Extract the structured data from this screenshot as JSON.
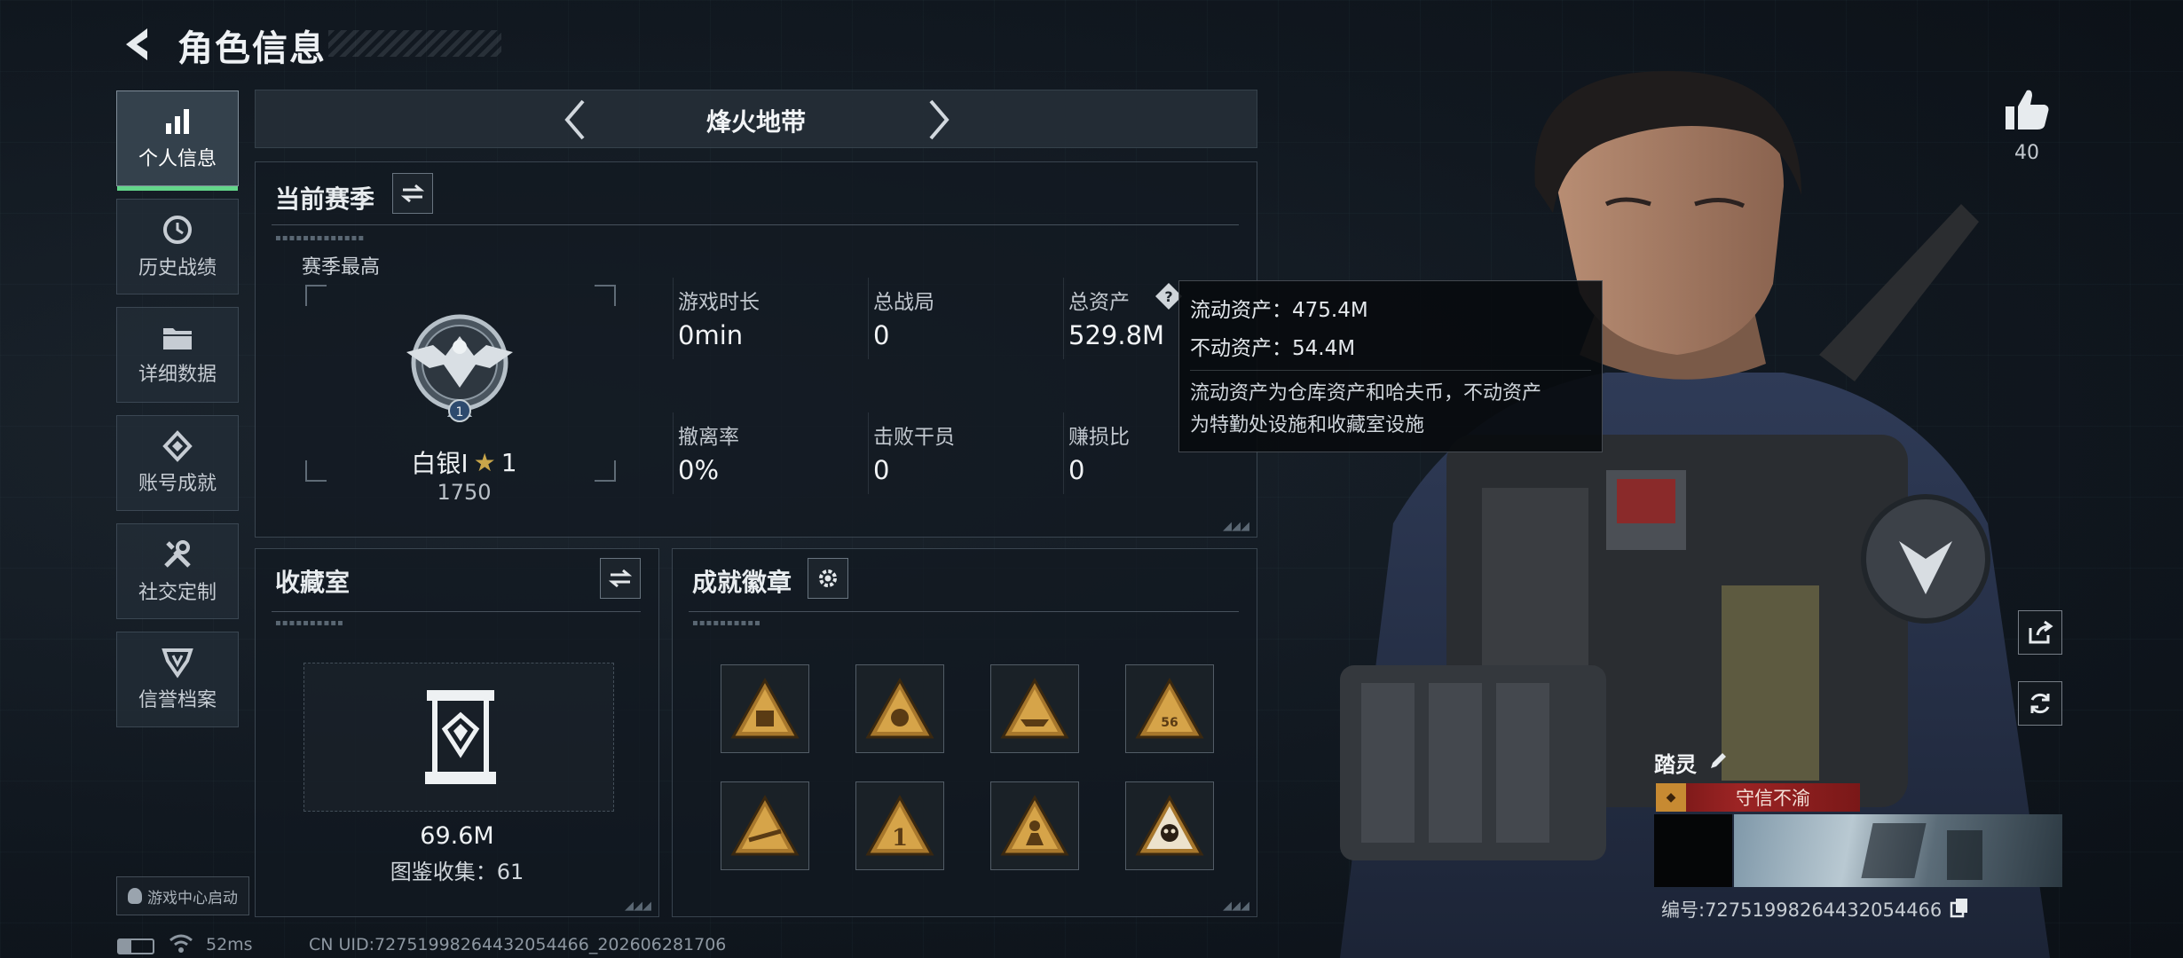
{
  "header": {
    "title": "角色信息"
  },
  "sidebar": {
    "items": [
      {
        "label": "个人信息",
        "icon": "bar-chart-icon",
        "active": true
      },
      {
        "label": "历史战绩",
        "icon": "history-clock-icon",
        "active": false
      },
      {
        "label": "详细数据",
        "icon": "folder-icon",
        "active": false
      },
      {
        "label": "账号成就",
        "icon": "achievement-diamond-icon",
        "active": false
      },
      {
        "label": "社交定制",
        "icon": "tools-icon",
        "active": false
      },
      {
        "label": "信誉档案",
        "icon": "shield-badge-icon",
        "active": false
      }
    ],
    "launch_label": "游戏中心启动"
  },
  "mode": {
    "name": "烽火地带"
  },
  "season": {
    "title": "当前赛季",
    "best_label": "赛季最高",
    "rank_name": "白银I",
    "rank_star": "1",
    "rank_points": "1750",
    "stats": [
      {
        "label": "游戏时长",
        "value": "0min"
      },
      {
        "label": "总战局",
        "value": "0"
      },
      {
        "label": "总资产",
        "value": "529.8M"
      },
      {
        "label": "撤离率",
        "value": "0%"
      },
      {
        "label": "击败干员",
        "value": "0"
      },
      {
        "label": "赚损比",
        "value": "0"
      }
    ]
  },
  "tooltip": {
    "liquid": "流动资产：475.4M",
    "fixed": "不动资产：54.4M",
    "desc_line1": "流动资产为仓库资产和哈夫币，不动资产",
    "desc_line2": "为特勤处设施和收藏室设施"
  },
  "collection": {
    "title": "收藏室",
    "value": "69.6M",
    "catalog": "图鉴收集：61"
  },
  "badges": {
    "title": "成就徽章",
    "count": 8
  },
  "likes": {
    "count": "40"
  },
  "player": {
    "name": "踏灵",
    "title_badge": "守信不渝",
    "uid_line": "编号:7275199826443205446​6"
  },
  "status_bar": {
    "ping": "52ms",
    "uid": "CN UID:72751998264432054466_202606281706"
  },
  "colors": {
    "accent_green": "#63d68a",
    "title_red": "#8c1c1c",
    "gold": "#c79a3a"
  }
}
